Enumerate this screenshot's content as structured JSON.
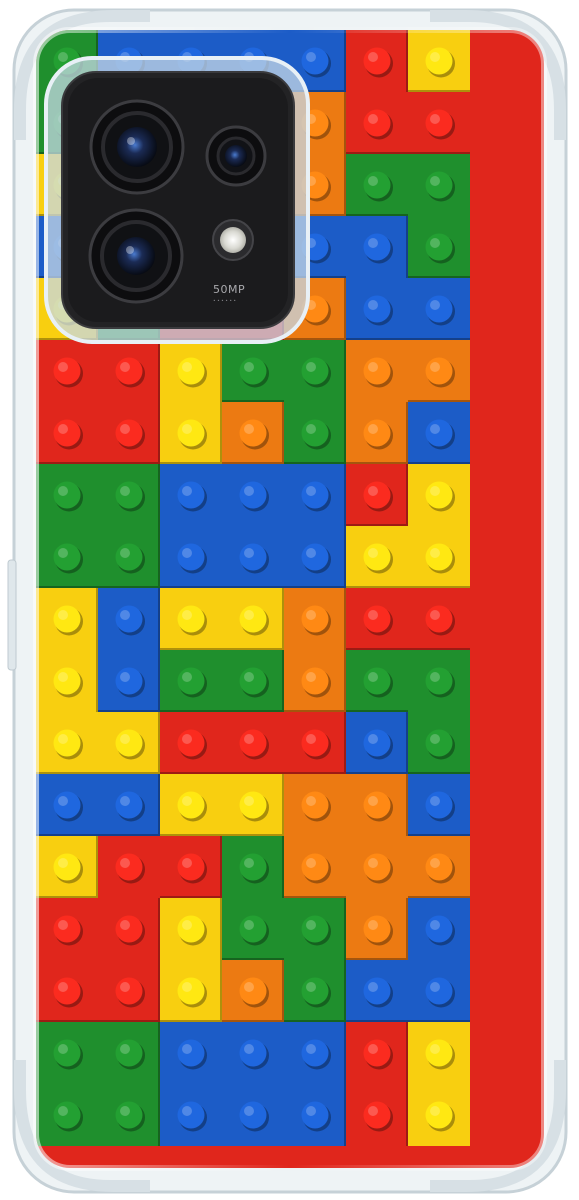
{
  "product": {
    "kind": "transparent shockproof phone case",
    "pattern": "toy building bricks"
  },
  "camera_module": {
    "label": "50MP",
    "sublabel": "• • • • • •"
  },
  "palette": {
    "red": "#e0261c",
    "orange": "#ec7a12",
    "yellow": "#f8cf10",
    "green": "#1f8f2d",
    "blue": "#1c5cc7",
    "case_edge": "#cdd7dc",
    "camera_body": "#1f1f21"
  }
}
